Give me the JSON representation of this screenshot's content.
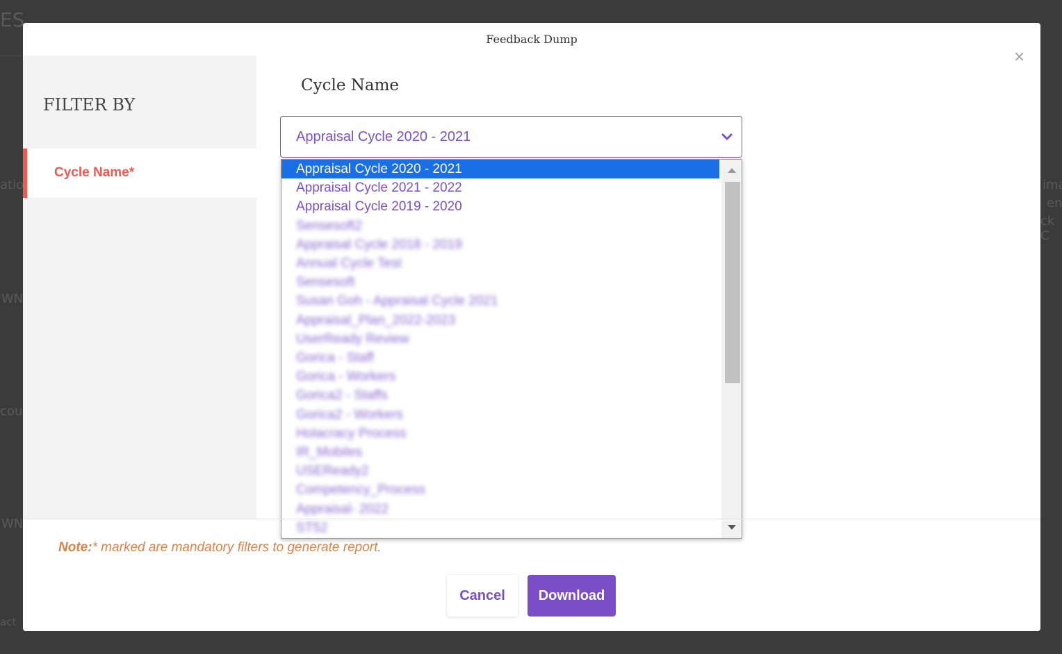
{
  "modal": {
    "title": "Feedback Dump",
    "close_symbol": "×",
    "sidebar": {
      "heading": "FILTER BY",
      "items": [
        {
          "label": "Cycle Name*"
        }
      ]
    },
    "main": {
      "field_label": "Cycle Name",
      "select": {
        "value": "Appraisal Cycle 2020 - 2021",
        "options": [
          {
            "label": "Appraisal Cycle 2020 - 2021",
            "selected": true,
            "blurred": false
          },
          {
            "label": "Appraisal Cycle 2021 - 2022",
            "selected": false,
            "blurred": false
          },
          {
            "label": "Appraisal Cycle 2019 - 2020",
            "selected": false,
            "blurred": false
          },
          {
            "label": "Sensesoft2",
            "selected": false,
            "blurred": true
          },
          {
            "label": "Appraisal Cycle 2018 - 2019",
            "selected": false,
            "blurred": true
          },
          {
            "label": "Annual Cycle Test",
            "selected": false,
            "blurred": true
          },
          {
            "label": "Sensesoft",
            "selected": false,
            "blurred": true
          },
          {
            "label": "Susan Goh - Appraisal Cycle 2021",
            "selected": false,
            "blurred": true
          },
          {
            "label": "Appraisal_Plan_2022-2023",
            "selected": false,
            "blurred": true
          },
          {
            "label": "UserReady Review",
            "selected": false,
            "blurred": true
          },
          {
            "label": "Gorica - Staff",
            "selected": false,
            "blurred": true
          },
          {
            "label": "Gorica - Workers",
            "selected": false,
            "blurred": true
          },
          {
            "label": "Gorica2 - Staffs",
            "selected": false,
            "blurred": true
          },
          {
            "label": "Gorica2 - Workers",
            "selected": false,
            "blurred": true
          },
          {
            "label": "Holacracy Process",
            "selected": false,
            "blurred": true
          },
          {
            "label": "IR_Mobiles",
            "selected": false,
            "blurred": true
          },
          {
            "label": "USEReady2",
            "selected": false,
            "blurred": true
          },
          {
            "label": "Competency_Process",
            "selected": false,
            "blurred": true
          },
          {
            "label": "Appraisal- 2022",
            "selected": false,
            "blurred": true
          },
          {
            "label": "ST52",
            "selected": false,
            "blurred": true
          }
        ]
      }
    },
    "note": {
      "prefix": "Note:",
      "text": "* marked are mandatory filters to generate report."
    },
    "buttons": {
      "cancel": "Cancel",
      "download": "Download"
    }
  },
  "background": {
    "fragments": [
      "ES",
      "atio",
      "WN",
      "cou",
      "WN",
      "act",
      "ima",
      "en",
      "ck C"
    ]
  },
  "colors": {
    "accent": "#7b4ec8",
    "active_filter": "#f05a4f",
    "note": "#d9834a",
    "selected_option": "#1a6ee6"
  }
}
